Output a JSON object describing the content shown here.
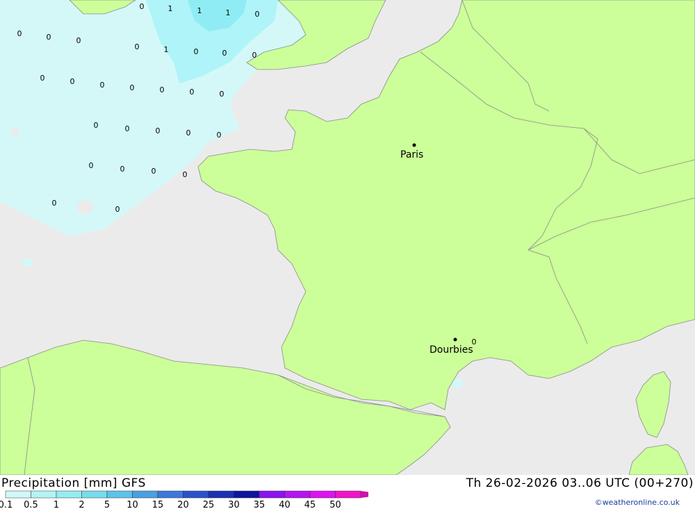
{
  "map": {
    "cities": [
      {
        "name": "Paris"
      },
      {
        "name": "Dourbies"
      }
    ],
    "precip_values": [
      "0",
      "1",
      "1",
      "1",
      "0",
      "0",
      "0",
      "0",
      "0",
      "1",
      "0",
      "0",
      "0",
      "0",
      "0",
      "0",
      "0",
      "0",
      "0",
      "0",
      "0",
      "0",
      "0",
      "0",
      "0",
      "0",
      "0",
      "0",
      "0",
      "0",
      "0",
      "0",
      "0"
    ],
    "colors": {
      "land": "#ccff99",
      "sea": "#ebebeb",
      "precip_light": "#d4f8f8",
      "precip_mid": "#aef4f8",
      "precip_strong": "#90ecf4",
      "border": "#8a8a8a"
    }
  },
  "footer": {
    "title": "Precipitation [mm] GFS",
    "datetime": "Th 26-02-2026 03..06 UTC (00+270)",
    "credit": "©weatheronline.co.uk"
  },
  "legend": {
    "labels": [
      "0.1",
      "0.5",
      "1",
      "2",
      "5",
      "10",
      "15",
      "20",
      "25",
      "30",
      "35",
      "40",
      "45",
      "50"
    ],
    "colors": [
      "#d2f8f8",
      "#b4f4f4",
      "#96ecf0",
      "#78dcec",
      "#5ac4e8",
      "#4aa0e0",
      "#3c78dc",
      "#2c50cc",
      "#1c30b4",
      "#10149a",
      "#8c14f0",
      "#b414f0",
      "#dc14f0",
      "#f014c8",
      "#c814a8"
    ]
  }
}
